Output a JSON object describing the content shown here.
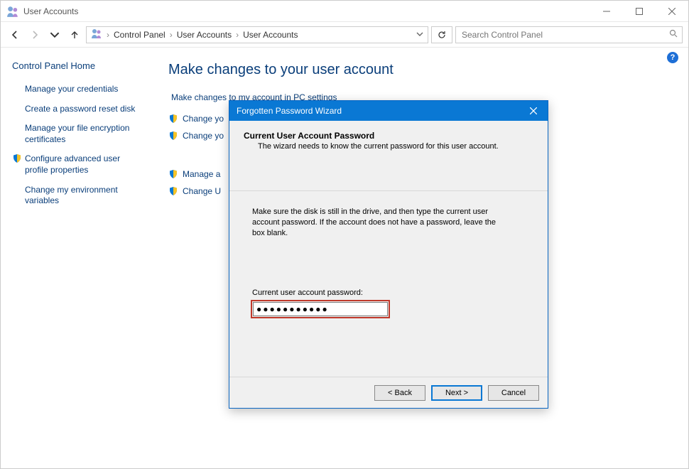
{
  "window": {
    "title": "User Accounts",
    "help_char": "?"
  },
  "nav": {
    "breadcrumbs": [
      "Control Panel",
      "User Accounts",
      "User Accounts"
    ],
    "search_placeholder": "Search Control Panel"
  },
  "sidebar": {
    "home": "Control Panel Home",
    "links": [
      {
        "label": "Manage your credentials",
        "shield": false
      },
      {
        "label": "Create a password reset disk",
        "shield": false
      },
      {
        "label": "Manage your file encryption certificates",
        "shield": false
      },
      {
        "label": "Configure advanced user profile properties",
        "shield": true
      },
      {
        "label": "Change my environment variables",
        "shield": false
      }
    ]
  },
  "main": {
    "heading": "Make changes to your user account",
    "tasks": [
      {
        "label": "Make changes to my account in PC settings",
        "shield": false
      },
      {
        "label": "Change yo",
        "shield": true
      },
      {
        "label": "Change yo",
        "shield": true
      },
      {
        "label": "Manage a",
        "shield": true
      },
      {
        "label": "Change U",
        "shield": true
      }
    ]
  },
  "wizard": {
    "title": "Forgotten Password Wizard",
    "heading": "Current User Account Password",
    "subheading": "The wizard needs to know the current password for this user account.",
    "instruction": "Make sure the disk is still in the drive, and then type the current user account password. If the account does not have a password, leave the box blank.",
    "field_label": "Current user account password:",
    "password_value": "●●●●●●●●●●●",
    "buttons": {
      "back": "< Back",
      "next": "Next >",
      "cancel": "Cancel"
    }
  }
}
